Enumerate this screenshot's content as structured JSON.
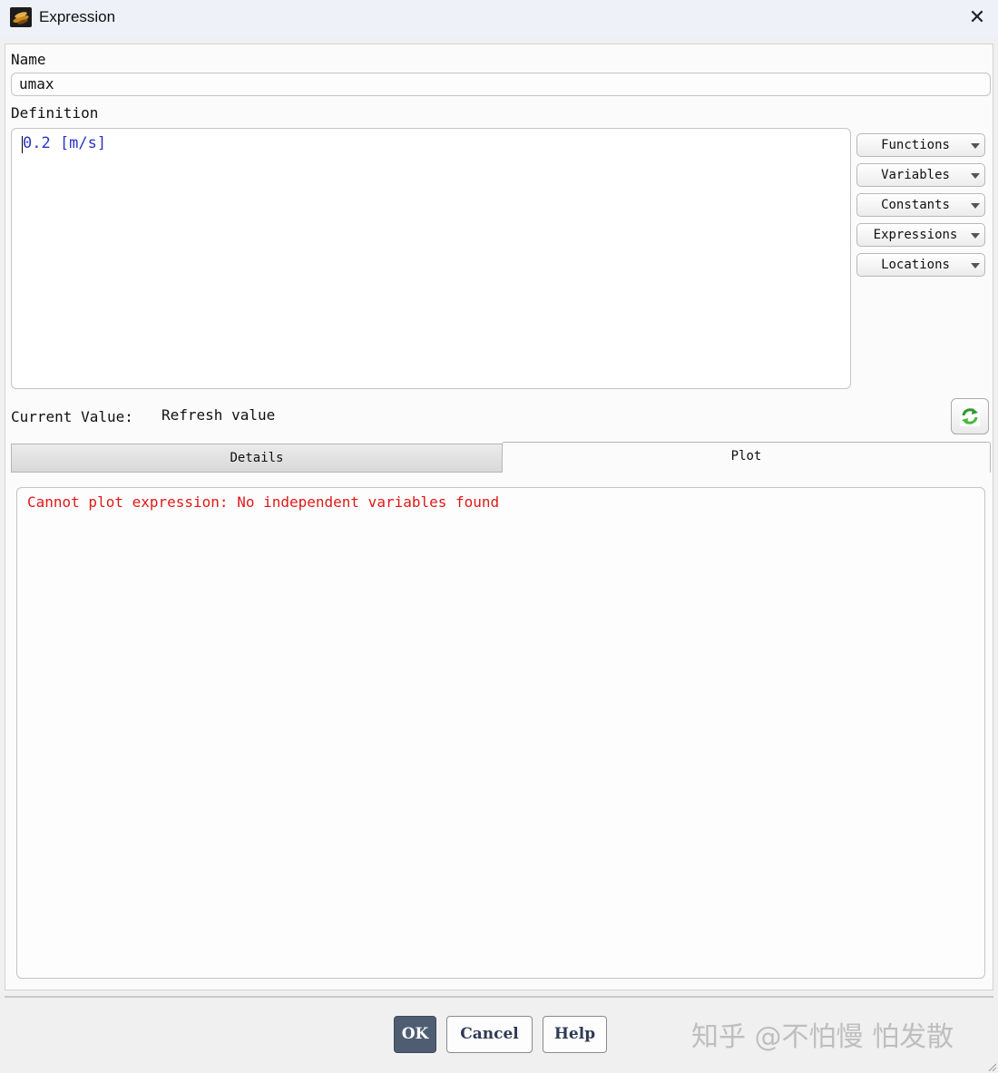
{
  "window": {
    "title": "Expression",
    "icon": "app-logo-icon",
    "close_icon": "close-icon"
  },
  "name": {
    "label": "Name",
    "value": "umax"
  },
  "definition": {
    "label": "Definition",
    "value": "0.2 [m/s]"
  },
  "side_menus": [
    {
      "label": "Functions",
      "icon": "chevron-down-icon"
    },
    {
      "label": "Variables",
      "icon": "chevron-down-icon"
    },
    {
      "label": "Constants",
      "icon": "chevron-down-icon"
    },
    {
      "label": "Expressions",
      "icon": "chevron-down-icon"
    },
    {
      "label": "Locations",
      "icon": "chevron-down-icon"
    }
  ],
  "current_value": {
    "label": "Current Value:",
    "value": "Refresh value",
    "refresh_icon": "refresh-icon"
  },
  "tabs": {
    "details": "Details",
    "plot": "Plot",
    "active": "plot"
  },
  "plot": {
    "message": "Cannot plot expression: No independent variables found",
    "message_color": "#e01818"
  },
  "buttons": {
    "ok": "OK",
    "cancel": "Cancel",
    "help": "Help"
  },
  "watermark": "知乎 @不怕慢 怕发散",
  "colors": {
    "definition_text": "#2a33c8",
    "ok_button": "#4f5d72"
  }
}
